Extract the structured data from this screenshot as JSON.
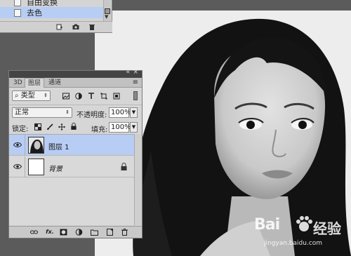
{
  "history": {
    "items": [
      {
        "label": "自由变换"
      },
      {
        "label": "去色"
      }
    ]
  },
  "layers_panel": {
    "tabs": [
      "3D",
      "图层",
      "通道"
    ],
    "filter": {
      "kind_label": "类型"
    },
    "blend": {
      "mode": "正常",
      "opacity_label": "不透明度:",
      "opacity_value": "100%"
    },
    "lock": {
      "label": "锁定:",
      "fill_label": "填充:",
      "fill_value": "100%"
    },
    "layers": [
      {
        "name": "图层 1",
        "selected": true
      },
      {
        "name": "背景",
        "selected": false,
        "locked": true
      }
    ],
    "footer_fx": "fx."
  },
  "watermark": {
    "brand": "Bai",
    "brand2": "经验",
    "url": "jingyan.baidu.com"
  },
  "colors": {
    "selection": "#b7cdf4",
    "panel": "#d6d6d6",
    "workspace": "#5b5b5b"
  }
}
